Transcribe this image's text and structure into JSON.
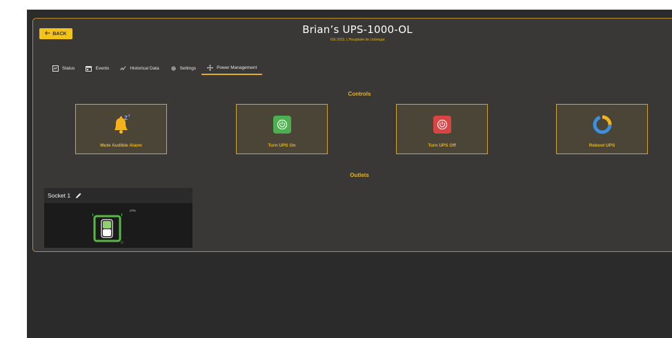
{
  "header": {
    "back_label": "BACK",
    "title": "Brian’s UPS-1000-OL",
    "subtitle": "ISE 2023, L'Hospitalet de Llobregat"
  },
  "tabs": [
    {
      "label": "Status",
      "icon": "status-icon"
    },
    {
      "label": "Events",
      "icon": "events-icon"
    },
    {
      "label": "Historical Data",
      "icon": "historical-data-icon"
    },
    {
      "label": "Settings",
      "icon": "gear-icon"
    },
    {
      "label": "Power Management",
      "icon": "power-management-icon",
      "active": true
    }
  ],
  "controls": {
    "heading": "Controls",
    "items": [
      {
        "label": "Mute Audible Alarm",
        "icon": "bell-snooze-icon"
      },
      {
        "label": "Turn UPS On",
        "icon": "power-on-icon"
      },
      {
        "label": "Turn UPS Off",
        "icon": "power-off-icon"
      },
      {
        "label": "Reboot UPS",
        "icon": "reboot-icon"
      }
    ]
  },
  "outlets": {
    "heading": "Outlets",
    "sockets": [
      {
        "name": "Socket 1",
        "state_label": "(ON)",
        "state": "on"
      }
    ]
  },
  "colors": {
    "accent": "#e6b422",
    "panel_border": "#b8902b",
    "on_green": "#4caf50",
    "off_red": "#d84545",
    "background": "#2b2b2b"
  }
}
